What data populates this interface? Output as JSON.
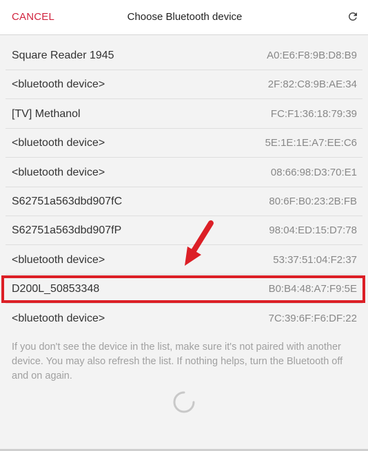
{
  "header": {
    "cancel_label": "CANCEL",
    "title": "Choose Bluetooth device",
    "refresh_icon": "refresh-icon"
  },
  "devices": [
    {
      "name": "Square Reader 1945",
      "mac": "A0:E6:F8:9B:D8:B9"
    },
    {
      "name": "<bluetooth device>",
      "mac": "2F:82:C8:9B:AE:34"
    },
    {
      "name": "[TV] Methanol",
      "mac": "FC:F1:36:18:79:39"
    },
    {
      "name": "<bluetooth device>",
      "mac": "5E:1E:1E:A7:EE:C6"
    },
    {
      "name": "<bluetooth device>",
      "mac": "08:66:98:D3:70:E1"
    },
    {
      "name": "S62751a563dbd907fC",
      "mac": "80:6F:B0:23:2B:FB"
    },
    {
      "name": "S62751a563dbd907fP",
      "mac": "98:04:ED:15:D7:78"
    },
    {
      "name": "<bluetooth device>",
      "mac": "53:37:51:04:F2:37"
    },
    {
      "name": "D200L_50853348",
      "mac": "B0:B4:48:A7:F9:5E"
    },
    {
      "name": "<bluetooth device>",
      "mac": "7C:39:6F:F6:DF:22"
    }
  ],
  "info_text": "If you don't see the device in the list, make sure it's not paired with another device. You may also refresh the list. If nothing helps, turn the Bluetooth off and on again.",
  "colors": {
    "accent": "#d1233e",
    "annotation_red": "#dc1f26"
  }
}
